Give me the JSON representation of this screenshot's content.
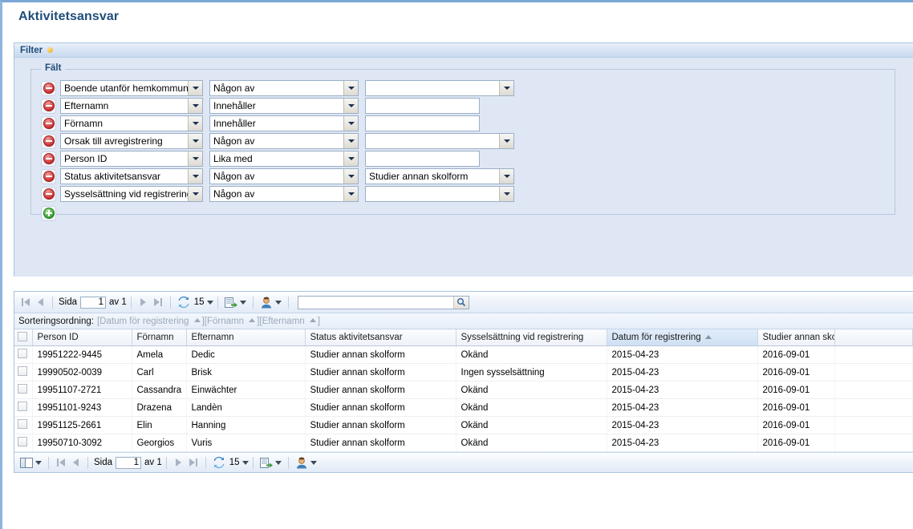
{
  "page": {
    "title": "Aktivitetsansvar"
  },
  "filter": {
    "header_label": "Filter",
    "status_dot": "modified-dot",
    "fieldset_legend": "Fält",
    "remove_button_label": "",
    "add_button_label": "",
    "rows": [
      {
        "field": "Boende utanför hemkommun",
        "operator": "Någon av",
        "value": "",
        "value_type": "select"
      },
      {
        "field": "Efternamn",
        "operator": "Innehåller",
        "value": "",
        "value_type": "text"
      },
      {
        "field": "Förnamn",
        "operator": "Innehåller",
        "value": "",
        "value_type": "text"
      },
      {
        "field": "Orsak till avregistrering",
        "operator": "Någon av",
        "value": "",
        "value_type": "select"
      },
      {
        "field": "Person ID",
        "operator": "Lika med",
        "value": "",
        "value_type": "text"
      },
      {
        "field": "Status aktivitetsansvar",
        "operator": "Någon av",
        "value": "Studier annan skolform",
        "value_type": "select"
      },
      {
        "field": "Sysselsättning vid registrering",
        "operator": "Någon av",
        "value": "",
        "value_type": "select"
      }
    ]
  },
  "toolbar": {
    "page_label": "Sida",
    "page_value": "1",
    "of_label": "av 1",
    "page_size": "15",
    "search_value": "",
    "search_placeholder": "",
    "refresh_icon": "refresh-icon",
    "export_icon": "export-icon",
    "user_icon": "user-icon",
    "search_icon": "search-icon",
    "first_icon": "first-page-icon",
    "prev_icon": "prev-page-icon",
    "next_icon": "next-page-icon",
    "last_icon": "last-page-icon",
    "columns_icon": "column-chooser-icon"
  },
  "sorting": {
    "label": "Sorteringsordning:",
    "items": [
      {
        "name": "Datum för registrering",
        "direction": "asc"
      },
      {
        "name": "Förnamn",
        "direction": "asc"
      },
      {
        "name": "Efternamn",
        "direction": "asc"
      }
    ]
  },
  "grid": {
    "columns": [
      {
        "label": "Person ID",
        "sorted": false
      },
      {
        "label": "Förnamn",
        "sorted": false
      },
      {
        "label": "Efternamn",
        "sorted": false
      },
      {
        "label": "Status aktivitetsansvar",
        "sorted": false
      },
      {
        "label": "Sysselsättning vid registrering",
        "sorted": false
      },
      {
        "label": "Datum för registrering",
        "sorted": true
      },
      {
        "label": "Studier annan skolform",
        "sorted": false
      }
    ],
    "rows": [
      {
        "person_id": "19951222-9445",
        "fornamn": "Amela",
        "efternamn": "Dedic",
        "status": "Studier annan skolform",
        "sysselsattning": "Okänd",
        "datum": "2015-04-23",
        "studier": "2016-09-01"
      },
      {
        "person_id": "19990502-0039",
        "fornamn": "Carl",
        "efternamn": "Brisk",
        "status": "Studier annan skolform",
        "sysselsattning": "Ingen sysselsättning",
        "datum": "2015-04-23",
        "studier": "2016-09-01"
      },
      {
        "person_id": "19951107-2721",
        "fornamn": "Cassandra",
        "efternamn": "Einwächter",
        "status": "Studier annan skolform",
        "sysselsattning": "Okänd",
        "datum": "2015-04-23",
        "studier": "2016-09-01"
      },
      {
        "person_id": "19951101-9243",
        "fornamn": "Drazena",
        "efternamn": "Landèn",
        "status": "Studier annan skolform",
        "sysselsattning": "Okänd",
        "datum": "2015-04-23",
        "studier": "2016-09-01"
      },
      {
        "person_id": "19951125-2661",
        "fornamn": "Elin",
        "efternamn": "Hanning",
        "status": "Studier annan skolform",
        "sysselsattning": "Okänd",
        "datum": "2015-04-23",
        "studier": "2016-09-01"
      },
      {
        "person_id": "19950710-3092",
        "fornamn": "Georgios",
        "efternamn": "Vuris",
        "status": "Studier annan skolform",
        "sysselsattning": "Okänd",
        "datum": "2015-04-23",
        "studier": "2016-09-01"
      }
    ]
  },
  "colors": {
    "title": "#1f4e79",
    "panel_bg": "#dfe7f5",
    "accent_border": "#a8c4e0",
    "sorted_header": "#cfe0f3"
  }
}
